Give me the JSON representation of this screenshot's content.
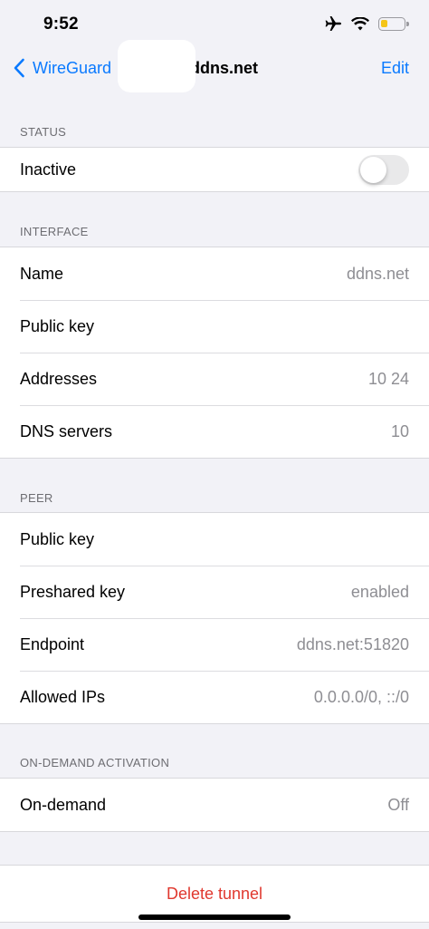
{
  "status_bar": {
    "time": "9:52",
    "icons": [
      "airplane-icon",
      "wifi-icon",
      "battery-icon"
    ],
    "battery_level": 0.3,
    "battery_color": "#f5c518"
  },
  "nav": {
    "back_label": "WireGuard",
    "title": ".ddns.net",
    "edit_label": "Edit",
    "accent_color": "#0a7aff"
  },
  "status_section": {
    "header": "STATUS",
    "rows": [
      {
        "label": "Inactive",
        "toggle_on": false
      }
    ]
  },
  "interface_section": {
    "header": "INTERFACE",
    "rows": [
      {
        "label": "Name",
        "value": "ddns.net"
      },
      {
        "label": "Public key",
        "value": ""
      },
      {
        "label": "Addresses",
        "value": "10      24"
      },
      {
        "label": "DNS servers",
        "value": "10"
      }
    ]
  },
  "peer_section": {
    "header": "PEER",
    "rows": [
      {
        "label": "Public key",
        "value": ""
      },
      {
        "label": "Preshared key",
        "value": "enabled"
      },
      {
        "label": "Endpoint",
        "value": "ddns.net:51820"
      },
      {
        "label": "Allowed IPs",
        "value": "0.0.0.0/0, ::/0"
      }
    ]
  },
  "on_demand_section": {
    "header": "ON-DEMAND ACTIVATION",
    "rows": [
      {
        "label": "On-demand",
        "value": "Off"
      }
    ]
  },
  "delete": {
    "label": "Delete tunnel",
    "color": "#e0382e"
  }
}
